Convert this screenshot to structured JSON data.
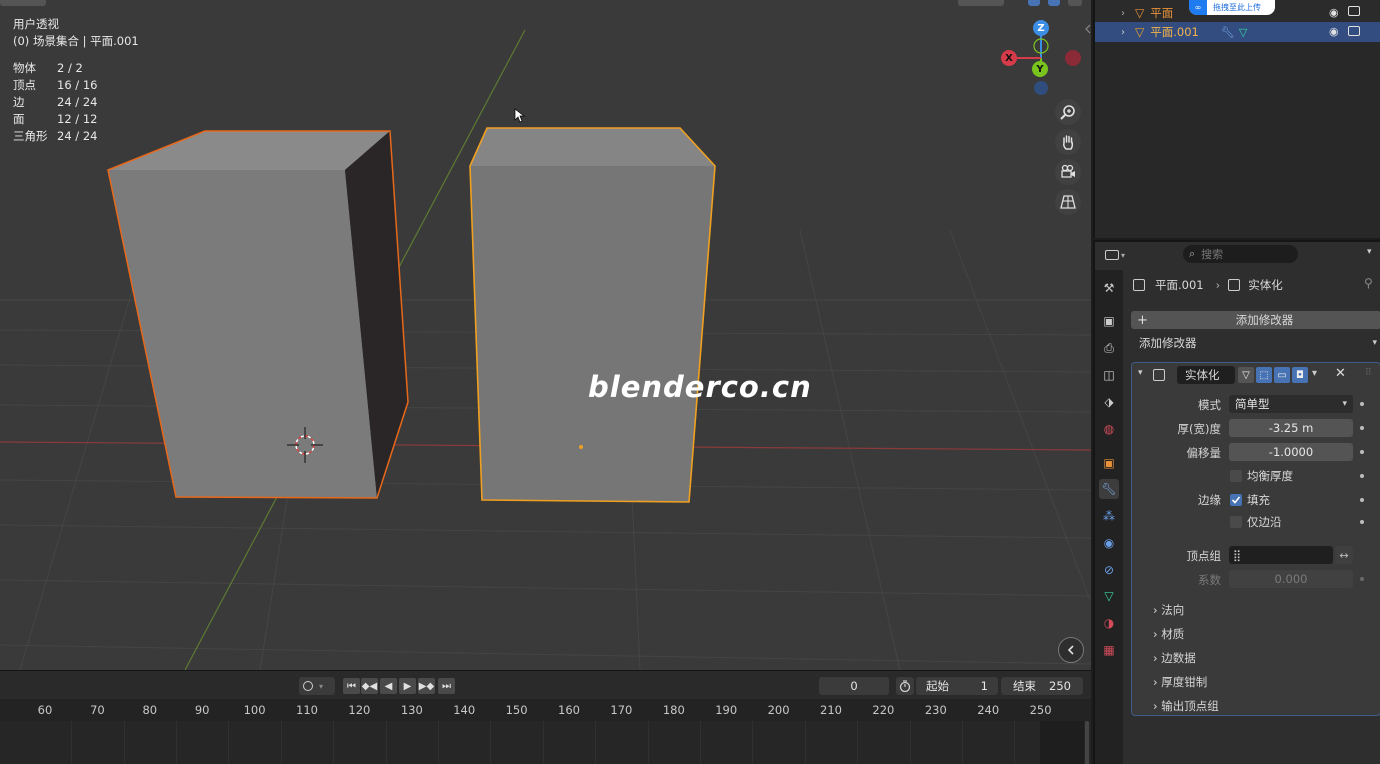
{
  "viewport": {
    "view_name": "用户透视",
    "collection_info": "(0) 场景集合 | 平面.001",
    "stats": [
      {
        "label": "物体",
        "value": "2 / 2"
      },
      {
        "label": "顶点",
        "value": "16 / 16"
      },
      {
        "label": "边",
        "value": "24 / 24"
      },
      {
        "label": "面",
        "value": "12 / 12"
      },
      {
        "label": "三角形",
        "value": "24 / 24"
      }
    ],
    "watermark": "blenderco.cn",
    "gizmo": {
      "z": "Z",
      "y": "Y",
      "x": "X"
    },
    "colors": {
      "active_outline": "#f0a020",
      "selected_outline": "#e8681a",
      "x_axis": "#d63b4a",
      "y_axis": "#7ac41e",
      "z_axis": "#3c8ee4"
    }
  },
  "timeline": {
    "current_frame": "0",
    "start_label": "起始",
    "start_value": "1",
    "end_label": "结束",
    "end_value": "250",
    "ruler": [
      "60",
      "70",
      "80",
      "90",
      "100",
      "110",
      "120",
      "130",
      "140",
      "150",
      "160",
      "170",
      "180",
      "190",
      "200",
      "210",
      "220",
      "230",
      "240",
      "250"
    ]
  },
  "outliner": {
    "badge_text": "拖拽至此上传",
    "items": [
      {
        "name": "平面"
      },
      {
        "name": "平面.001"
      }
    ]
  },
  "properties": {
    "search_placeholder": "搜索",
    "breadcrumb_object": "平面.001",
    "breadcrumb_modifier": "实体化",
    "add_modifier_button": "添加修改器",
    "add_modifier_menu": "添加修改器",
    "modifier": {
      "name": "实体化",
      "mode_label": "模式",
      "mode_value": "简单型",
      "thickness_label": "厚(宽)度",
      "thickness_value": "-3.25 m",
      "offset_label": "偏移量",
      "offset_value": "-1.0000",
      "even_thickness_label": "均衡厚度",
      "rim_label": "边缘",
      "fill_label": "填充",
      "only_rim_label": "仅边沿",
      "vertex_group_label": "顶点组",
      "factor_label": "系数",
      "factor_value": "0.000",
      "subpanels": [
        "法向",
        "材质",
        "边数据",
        "厚度钳制",
        "输出顶点组"
      ]
    }
  }
}
